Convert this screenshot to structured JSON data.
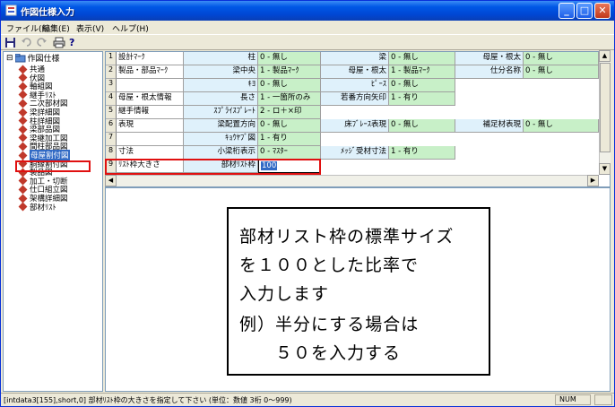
{
  "window": {
    "title": "作図仕様入力",
    "minimize": "_",
    "maximize": "□",
    "close": "✕"
  },
  "menu": [
    "ファイル(F)",
    "編集(E)",
    "表示(V)",
    "ヘルプ(H)"
  ],
  "toolbar": {
    "save_icon": "save-icon",
    "undo_icon": "undo-icon",
    "redo_icon": "redo-icon",
    "print_icon": "print-icon",
    "help_icon": "help-icon",
    "help_glyph": "?"
  },
  "tree": {
    "root_label": "作図仕様",
    "root_toggle": "⊟",
    "items": [
      "共通",
      "伏図",
      "軸組図",
      "継手ﾘｽﾄ",
      "二次部材図",
      "梁詳細図",
      "柱詳細図",
      "梁部品図",
      "梁継加工図",
      "間柱部品図",
      "母屋割付図",
      "胴縁割付図",
      "製品図",
      "加工・切断",
      "仕口組立図",
      "架構詳細図",
      "部材ﾘｽﾄ"
    ],
    "selected_index": 10
  },
  "grid": {
    "rows": [
      {
        "num": "1",
        "label": "設計ﾏｰｸ",
        "cells": [
          [
            "柱",
            "0 - 無し"
          ],
          [
            "梁",
            "0 - 無し"
          ],
          [
            "母屋・根太",
            "0 - 無し"
          ]
        ]
      },
      {
        "num": "2",
        "label": "製品・部品ﾏｰｸ",
        "cells": [
          [
            "梁中央",
            "1 - 製品ﾏｰｸ"
          ],
          [
            "母屋・根太",
            "1 - 製品ﾏｰｸ"
          ],
          [
            "仕分名称",
            "0 - 無し"
          ]
        ]
      },
      {
        "num": "3",
        "label": "",
        "cells": [
          [
            "ｷﾖ",
            "0 - 無し"
          ],
          [
            "ﾋﾟｰｽ",
            "0 - 無し"
          ]
        ]
      },
      {
        "num": "4",
        "label": "母屋・根太情報",
        "cells": [
          [
            "長さ",
            "1 - 一箇所のみ"
          ],
          [
            "若番方向矢印",
            "1 - 有り"
          ]
        ]
      },
      {
        "num": "5",
        "label": "継手情報",
        "cells": [
          [
            "ｽﾌﾟﾗｲｽﾌﾟﾚｰﾄ",
            "2 - ロ＋×印"
          ]
        ]
      },
      {
        "num": "6",
        "label": "表現",
        "cells": [
          [
            "梁配置方向",
            "0 - 無し"
          ],
          [
            "床ﾌﾞﾚｰｽ表現",
            "0 - 無し"
          ],
          [
            "補足材表現",
            "0 - 無し"
          ]
        ]
      },
      {
        "num": "7",
        "label": "",
        "cells": [
          [
            "ｷｮｳﾔﾌﾞ図",
            "1 - 有り"
          ]
        ]
      },
      {
        "num": "8",
        "label": "寸法",
        "cells": [
          [
            "小梁桁表示",
            "0 - ﾏｽﾀｰ"
          ],
          [
            "ﾒｯｼﾞ受材寸法",
            "1 - 有り"
          ]
        ]
      },
      {
        "num": "9",
        "label": "ﾘｽﾄ枠大きさ",
        "cells": [
          [
            "部材ﾘｽﾄ枠",
            "100"
          ]
        ]
      }
    ]
  },
  "help": {
    "lines": [
      "部材リスト枠の標準サイズ",
      "を１００とした比率で",
      "入力します",
      "例）半分にする場合は",
      "　　５０を入力する"
    ]
  },
  "status": {
    "text": "[intdata3[155],short,0] 部材ﾘｽﾄ枠の大きさを指定して下さい (単位：数値 3桁 0～999)",
    "num": "NUM"
  },
  "colors": {
    "accent": "#0058e6",
    "highlight": "#e01010",
    "value_bg": "#c8f0c8",
    "key_bg": "#dff1fb"
  }
}
